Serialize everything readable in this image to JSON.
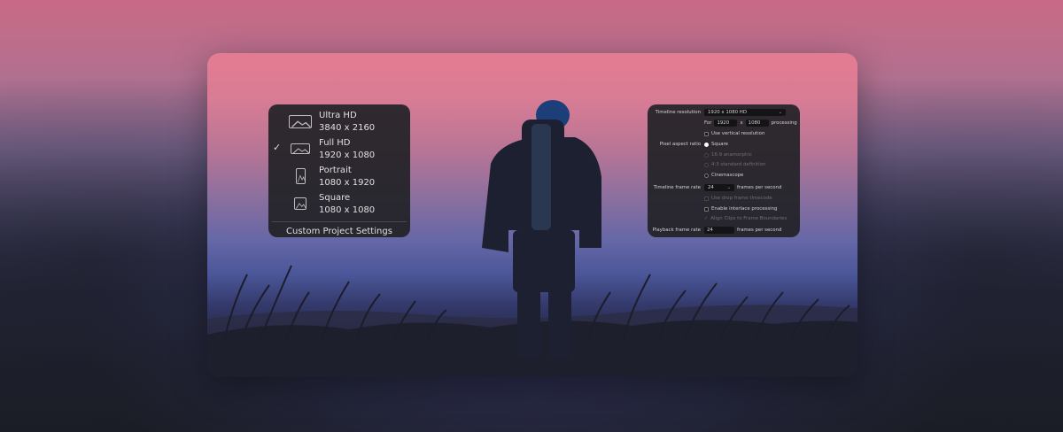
{
  "presets": [
    {
      "name": "Ultra HD",
      "res": "3840 x 2160",
      "selected": false,
      "shape": "ultra"
    },
    {
      "name": "Full HD",
      "res": "1920 x 1080",
      "selected": true,
      "shape": "wide"
    },
    {
      "name": "Portrait",
      "res": "1080 x 1920",
      "selected": false,
      "shape": "portrait"
    },
    {
      "name": "Square",
      "res": "1080 x 1080",
      "selected": false,
      "shape": "square"
    }
  ],
  "check_mark": "✓",
  "custom_label": "Custom Project Settings",
  "settings": {
    "timeline_resolution_label": "Timeline resolution",
    "timeline_resolution_value": "1920 x 1080 HD",
    "for_label": "For",
    "width_value": "1920",
    "x_label": "x",
    "height_value": "1080",
    "processing_label": "processing",
    "use_vertical_label": "Use vertical resolution",
    "pixel_aspect_label": "Pixel aspect ratio",
    "square_label": "Square",
    "anamorphic_label": "16:9 anamorphic",
    "standard_def_label": "4:3 standard definition",
    "cinemascope_label": "Cinemascope",
    "frame_rate_label": "Timeline frame rate",
    "frame_rate_value": "24",
    "fps_label": "frames per second",
    "drop_frame_label": "Use drop frame timecode",
    "interlace_label": "Enable interlace processing",
    "align_clips_label": "Align Clips to Frame Boundaries",
    "playback_label": "Playback frame rate",
    "playback_value": "24",
    "playback_fps_label": "frames per second"
  }
}
